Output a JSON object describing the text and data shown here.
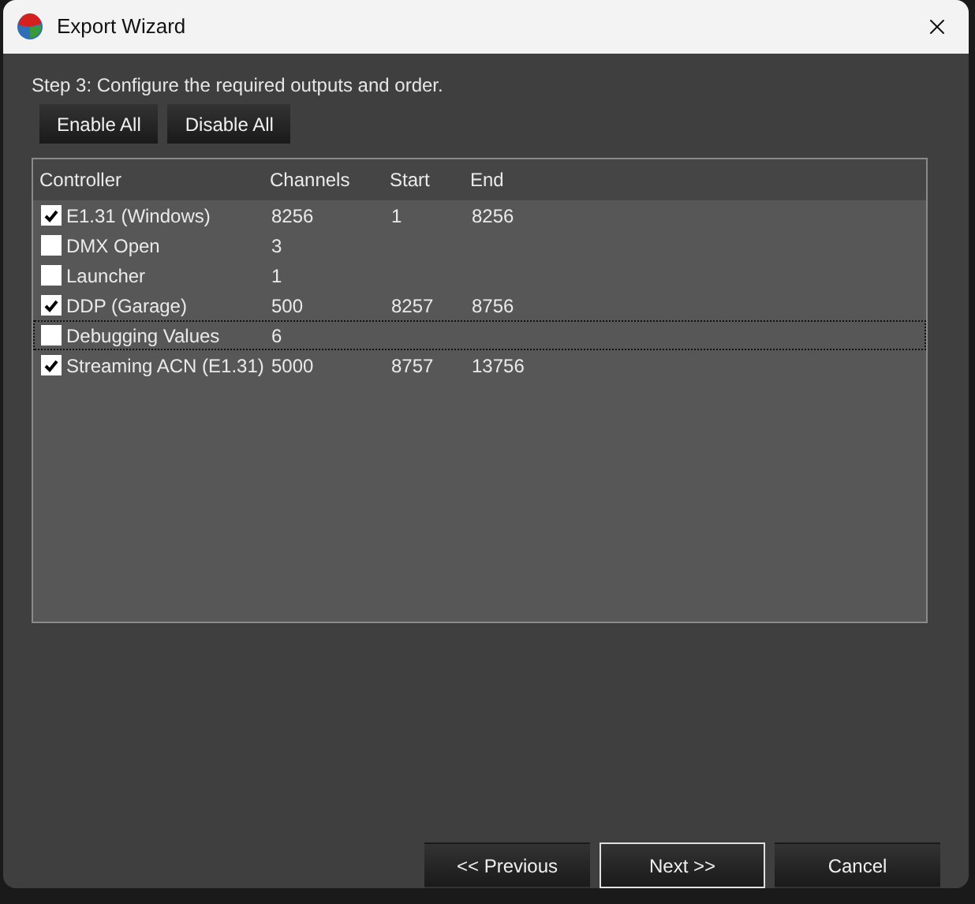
{
  "window": {
    "title": "Export Wizard"
  },
  "instruction": "Step 3:  Configure the required outputs and order.",
  "toolbar_buttons": [
    "Enable All",
    "Disable All"
  ],
  "table": {
    "columns": [
      "Controller",
      "Channels",
      "Start",
      "End"
    ],
    "rows": [
      {
        "checked": true,
        "focused": false,
        "cells": [
          "E1.31 (Windows)",
          "8256",
          "1",
          "8256"
        ]
      },
      {
        "checked": false,
        "focused": false,
        "cells": [
          "DMX Open",
          "3",
          "",
          ""
        ]
      },
      {
        "checked": false,
        "focused": false,
        "cells": [
          "Launcher",
          "1",
          "",
          ""
        ]
      },
      {
        "checked": true,
        "focused": false,
        "cells": [
          "DDP (Garage)",
          "500",
          "8257",
          "8756"
        ]
      },
      {
        "checked": false,
        "focused": true,
        "cells": [
          "Debugging Values",
          "6",
          "",
          ""
        ]
      },
      {
        "checked": true,
        "focused": false,
        "cells": [
          "Streaming ACN (E1.31)",
          "5000",
          "8757",
          "13756"
        ]
      }
    ]
  },
  "footer_buttons": [
    {
      "label": "<< Previous",
      "selected": false
    },
    {
      "label": "Next >>",
      "selected": true
    },
    {
      "label": "Cancel",
      "selected": false
    }
  ]
}
